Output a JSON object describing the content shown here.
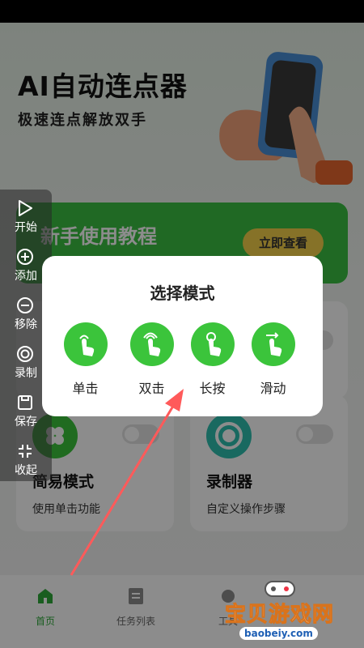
{
  "hero": {
    "title": "AI自动连点器",
    "subtitle": "极速连点解放双手"
  },
  "tutorial": {
    "title": "新手使用教程",
    "button": "立即查看"
  },
  "cards": [
    {
      "title": "简易模式",
      "desc": "使用单击功能",
      "icon": "clover-icon"
    },
    {
      "title": "录制器",
      "desc": "自定义操作步骤",
      "icon": "record-icon"
    }
  ],
  "float_toolbar": {
    "items": [
      {
        "label": "开始",
        "icon": "play-icon"
      },
      {
        "label": "添加",
        "icon": "plus-circle-icon"
      },
      {
        "label": "移除",
        "icon": "minus-circle-icon"
      },
      {
        "label": "录制",
        "icon": "record-icon"
      },
      {
        "label": "保存",
        "icon": "save-icon"
      },
      {
        "label": "收起",
        "icon": "collapse-icon"
      }
    ]
  },
  "dialog": {
    "title": "选择模式",
    "modes": [
      {
        "label": "单击",
        "icon": "tap-icon"
      },
      {
        "label": "双击",
        "icon": "double-tap-icon"
      },
      {
        "label": "长按",
        "icon": "long-press-icon"
      },
      {
        "label": "滑动",
        "icon": "swipe-icon"
      }
    ]
  },
  "tabbar": {
    "tabs": [
      {
        "label": "首页",
        "icon": "home-icon",
        "active": true
      },
      {
        "label": "任务列表",
        "icon": "list-icon",
        "active": false
      },
      {
        "label": "工具",
        "icon": "tools-icon",
        "active": false
      }
    ]
  },
  "watermark": {
    "text": "宝贝游戏网",
    "url": "baobeiy.com"
  },
  "colors": {
    "accent": "#3bc43b",
    "tutorial_bg": "#3bbf42",
    "button_yellow": "#f5d04a"
  }
}
